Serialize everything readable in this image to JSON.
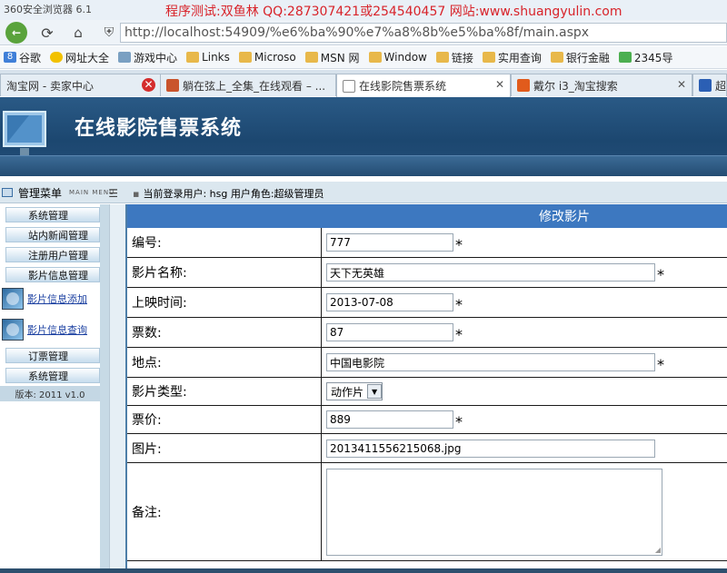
{
  "browser": {
    "app_title": "360安全浏览器 6.1",
    "promo": "程序测试:双鱼林 QQ:287307421或254540457 网站:www.shuangyulin.com",
    "address": "http://localhost:54909/%e6%ba%90%e7%a8%8b%e5%ba%8f/main.aspx",
    "favorites": [
      "谷歌",
      "网址大全",
      "游戏中心",
      "Links",
      "Microso",
      "MSN 网",
      "Window",
      "链接",
      "实用查询",
      "银行金融",
      "2345导"
    ],
    "tabs": [
      {
        "label": "淘宝网 - 卖家中心"
      },
      {
        "label": "躺在弦上_全集_在线观看 – ..."
      },
      {
        "label": "在线影院售票系统"
      },
      {
        "label": "戴尔 i3_淘宝搜索"
      },
      {
        "label": "超级"
      }
    ]
  },
  "header": {
    "system_title": "在线影院售票系统"
  },
  "infobar": {
    "menu_title": "管理菜单",
    "menu_title_en": "MAIN MENU",
    "login_text": "当前登录用户: hsg  用户角色:超级管理员"
  },
  "sidebar": {
    "items": [
      {
        "label": "系统管理"
      },
      {
        "label": "站内新闻管理"
      },
      {
        "label": "注册用户管理"
      },
      {
        "label": "影片信息管理"
      }
    ],
    "subitems": [
      {
        "label": "影片信息添加"
      },
      {
        "label": "影片信息查询"
      }
    ],
    "items2": [
      {
        "label": "订票管理"
      },
      {
        "label": "系统管理"
      }
    ],
    "version": "版本: 2011 v1.0"
  },
  "form": {
    "title": "修改影片",
    "fields": {
      "id": {
        "label": "编号:",
        "value": "777",
        "required": "*"
      },
      "name": {
        "label": "影片名称:",
        "value": "天下无英雄",
        "required": "*"
      },
      "date": {
        "label": "上映时间:",
        "value": "2013-07-08",
        "required": "*"
      },
      "tickets": {
        "label": "票数:",
        "value": "87",
        "required": "*"
      },
      "place": {
        "label": "地点:",
        "value": "中国电影院",
        "required": "*"
      },
      "type": {
        "label": "影片类型:",
        "value": "动作片"
      },
      "price": {
        "label": "票价:",
        "value": "889",
        "required": "*"
      },
      "image": {
        "label": "图片:",
        "value": "2013411556215068.jpg"
      },
      "note": {
        "label": "备注:",
        "value": ""
      }
    }
  }
}
